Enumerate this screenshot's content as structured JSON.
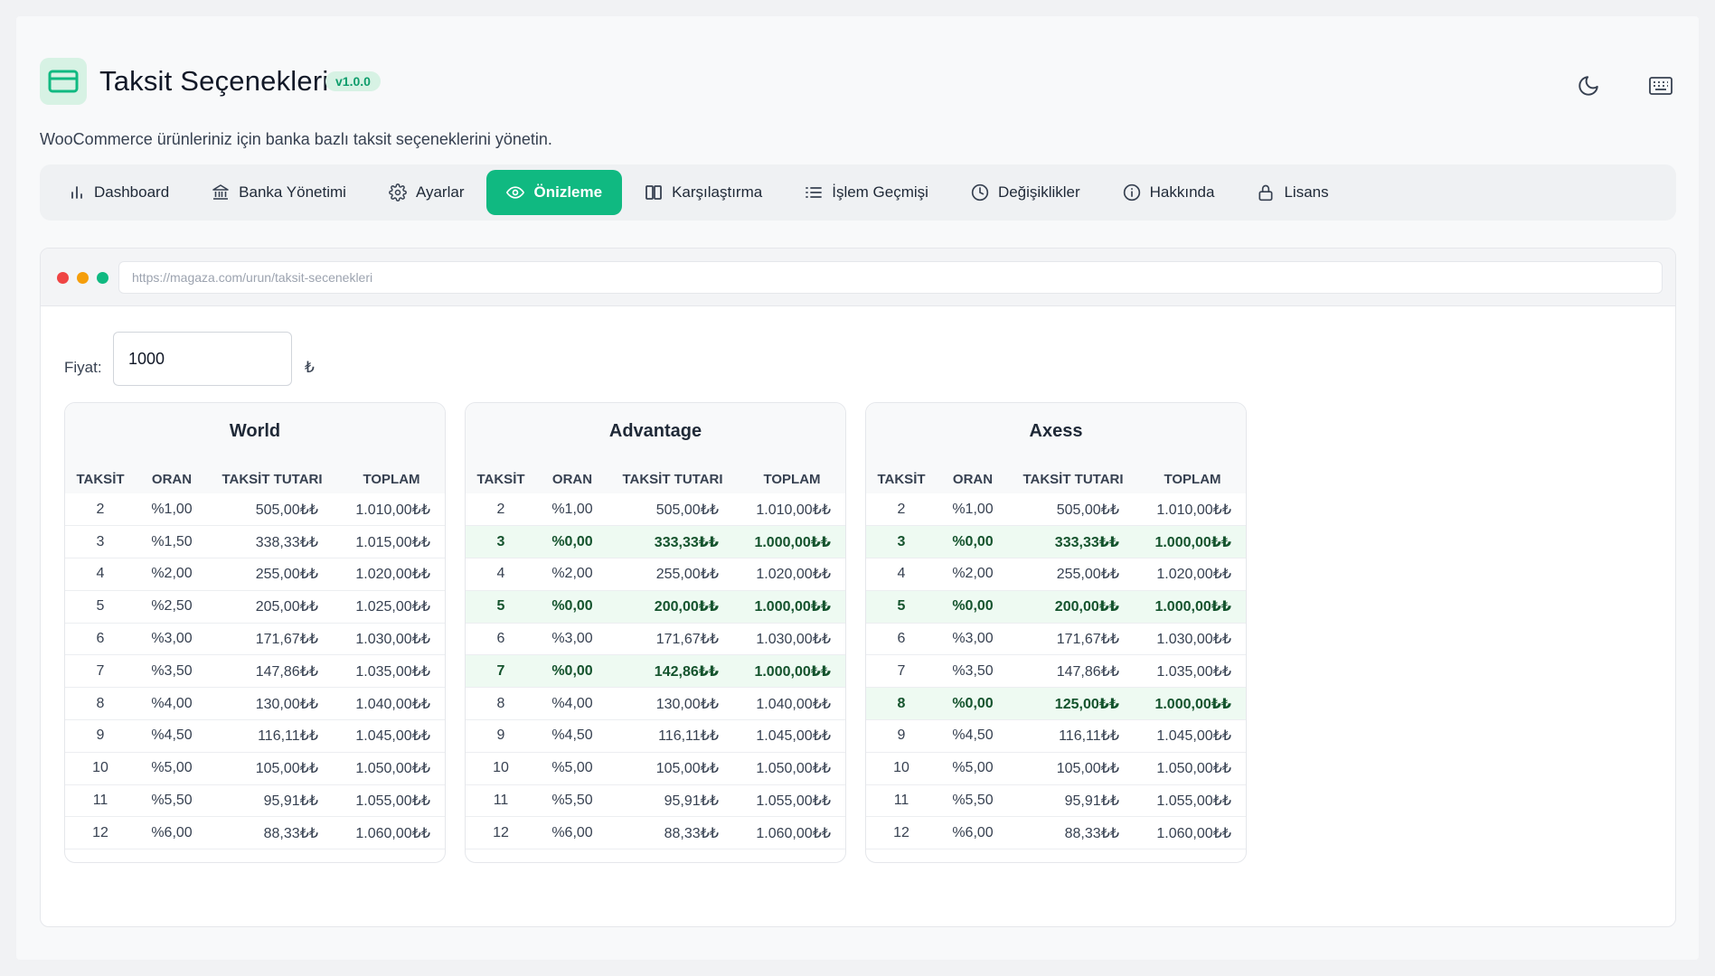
{
  "header": {
    "title": "Taksit Seçenekleri",
    "version": "v1.0.0",
    "subtitle": "WooCommerce ürünleriniz için banka bazlı taksit seçeneklerini yönetin."
  },
  "tabs": [
    {
      "label": "Dashboard",
      "icon": "bar-chart-icon",
      "active": false
    },
    {
      "label": "Banka Yönetimi",
      "icon": "bank-icon",
      "active": false
    },
    {
      "label": "Ayarlar",
      "icon": "gear-icon",
      "active": false
    },
    {
      "label": "Önizleme",
      "icon": "eye-icon",
      "active": true
    },
    {
      "label": "Karşılaştırma",
      "icon": "compare-icon",
      "active": false
    },
    {
      "label": "İşlem Geçmişi",
      "icon": "list-icon",
      "active": false
    },
    {
      "label": "Değişiklikler",
      "icon": "clock-icon",
      "active": false
    },
    {
      "label": "Hakkında",
      "icon": "info-icon",
      "active": false
    },
    {
      "label": "Lisans",
      "icon": "lock-icon",
      "active": false
    }
  ],
  "preview": {
    "url": "https://magaza.com/urun/taksit-secenekleri",
    "price_label": "Fiyat:",
    "price_value": "1000",
    "currency": "₺"
  },
  "columns": [
    "TAKSİT",
    "ORAN",
    "TAKSİT TUTARI",
    "TOPLAM"
  ],
  "banks": [
    {
      "name": "World",
      "rows": [
        {
          "inst": "2",
          "rate": "%1,00",
          "amount": "505,00₺₺",
          "total": "1.010,00₺₺",
          "promo": false
        },
        {
          "inst": "3",
          "rate": "%1,50",
          "amount": "338,33₺₺",
          "total": "1.015,00₺₺",
          "promo": false
        },
        {
          "inst": "4",
          "rate": "%2,00",
          "amount": "255,00₺₺",
          "total": "1.020,00₺₺",
          "promo": false
        },
        {
          "inst": "5",
          "rate": "%2,50",
          "amount": "205,00₺₺",
          "total": "1.025,00₺₺",
          "promo": false
        },
        {
          "inst": "6",
          "rate": "%3,00",
          "amount": "171,67₺₺",
          "total": "1.030,00₺₺",
          "promo": false
        },
        {
          "inst": "7",
          "rate": "%3,50",
          "amount": "147,86₺₺",
          "total": "1.035,00₺₺",
          "promo": false
        },
        {
          "inst": "8",
          "rate": "%4,00",
          "amount": "130,00₺₺",
          "total": "1.040,00₺₺",
          "promo": false
        },
        {
          "inst": "9",
          "rate": "%4,50",
          "amount": "116,11₺₺",
          "total": "1.045,00₺₺",
          "promo": false
        },
        {
          "inst": "10",
          "rate": "%5,00",
          "amount": "105,00₺₺",
          "total": "1.050,00₺₺",
          "promo": false
        },
        {
          "inst": "11",
          "rate": "%5,50",
          "amount": "95,91₺₺",
          "total": "1.055,00₺₺",
          "promo": false
        },
        {
          "inst": "12",
          "rate": "%6,00",
          "amount": "88,33₺₺",
          "total": "1.060,00₺₺",
          "promo": false
        }
      ]
    },
    {
      "name": "Advantage",
      "rows": [
        {
          "inst": "2",
          "rate": "%1,00",
          "amount": "505,00₺₺",
          "total": "1.010,00₺₺",
          "promo": false
        },
        {
          "inst": "3",
          "rate": "%0,00",
          "amount": "333,33₺₺",
          "total": "1.000,00₺₺",
          "promo": true
        },
        {
          "inst": "4",
          "rate": "%2,00",
          "amount": "255,00₺₺",
          "total": "1.020,00₺₺",
          "promo": false
        },
        {
          "inst": "5",
          "rate": "%0,00",
          "amount": "200,00₺₺",
          "total": "1.000,00₺₺",
          "promo": true
        },
        {
          "inst": "6",
          "rate": "%3,00",
          "amount": "171,67₺₺",
          "total": "1.030,00₺₺",
          "promo": false
        },
        {
          "inst": "7",
          "rate": "%0,00",
          "amount": "142,86₺₺",
          "total": "1.000,00₺₺",
          "promo": true
        },
        {
          "inst": "8",
          "rate": "%4,00",
          "amount": "130,00₺₺",
          "total": "1.040,00₺₺",
          "promo": false
        },
        {
          "inst": "9",
          "rate": "%4,50",
          "amount": "116,11₺₺",
          "total": "1.045,00₺₺",
          "promo": false
        },
        {
          "inst": "10",
          "rate": "%5,00",
          "amount": "105,00₺₺",
          "total": "1.050,00₺₺",
          "promo": false
        },
        {
          "inst": "11",
          "rate": "%5,50",
          "amount": "95,91₺₺",
          "total": "1.055,00₺₺",
          "promo": false
        },
        {
          "inst": "12",
          "rate": "%6,00",
          "amount": "88,33₺₺",
          "total": "1.060,00₺₺",
          "promo": false
        }
      ]
    },
    {
      "name": "Axess",
      "rows": [
        {
          "inst": "2",
          "rate": "%1,00",
          "amount": "505,00₺₺",
          "total": "1.010,00₺₺",
          "promo": false
        },
        {
          "inst": "3",
          "rate": "%0,00",
          "amount": "333,33₺₺",
          "total": "1.000,00₺₺",
          "promo": true
        },
        {
          "inst": "4",
          "rate": "%2,00",
          "amount": "255,00₺₺",
          "total": "1.020,00₺₺",
          "promo": false
        },
        {
          "inst": "5",
          "rate": "%0,00",
          "amount": "200,00₺₺",
          "total": "1.000,00₺₺",
          "promo": true
        },
        {
          "inst": "6",
          "rate": "%3,00",
          "amount": "171,67₺₺",
          "total": "1.030,00₺₺",
          "promo": false
        },
        {
          "inst": "7",
          "rate": "%3,50",
          "amount": "147,86₺₺",
          "total": "1.035,00₺₺",
          "promo": false
        },
        {
          "inst": "8",
          "rate": "%0,00",
          "amount": "125,00₺₺",
          "total": "1.000,00₺₺",
          "promo": true
        },
        {
          "inst": "9",
          "rate": "%4,50",
          "amount": "116,11₺₺",
          "total": "1.045,00₺₺",
          "promo": false
        },
        {
          "inst": "10",
          "rate": "%5,00",
          "amount": "105,00₺₺",
          "total": "1.050,00₺₺",
          "promo": false
        },
        {
          "inst": "11",
          "rate": "%5,50",
          "amount": "95,91₺₺",
          "total": "1.055,00₺₺",
          "promo": false
        },
        {
          "inst": "12",
          "rate": "%6,00",
          "amount": "88,33₺₺",
          "total": "1.060,00₺₺",
          "promo": false
        }
      ]
    }
  ],
  "colors": {
    "accent": "#10b981",
    "accent_soft": "#d7f2e4",
    "promo_row": "#eefaf2",
    "dot_red": "#ef4444",
    "dot_yellow": "#f59e0b",
    "dot_green": "#10b981"
  },
  "icons": {
    "logo": "credit-card-icon",
    "theme_toggle": "moon-icon",
    "shortcuts": "keyboard-icon"
  }
}
